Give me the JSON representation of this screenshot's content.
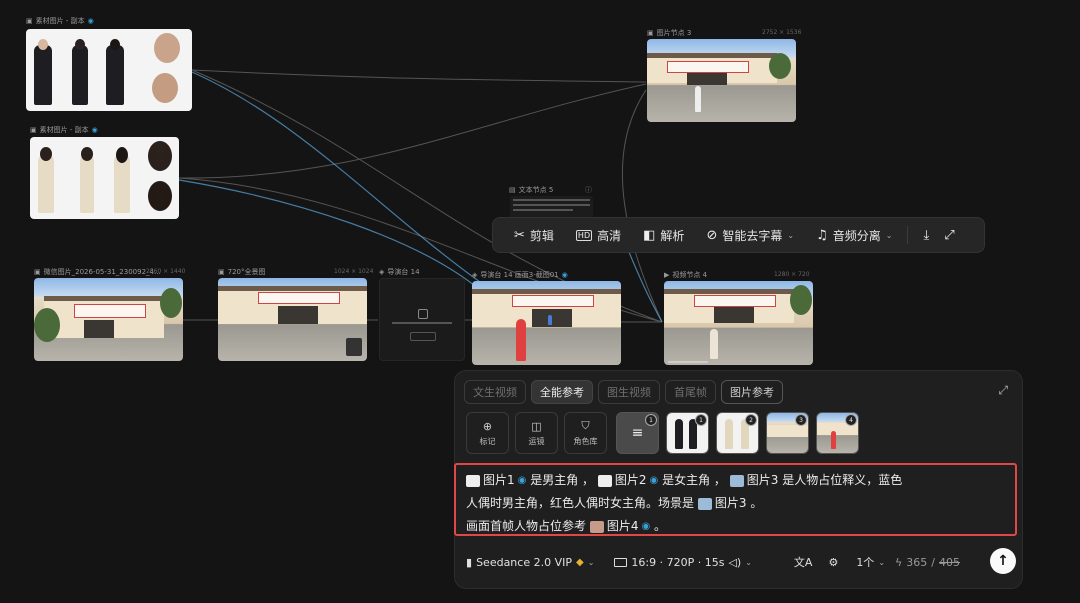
{
  "nodes": {
    "male_ref": {
      "label": "素材图片 - 副本"
    },
    "female_ref": {
      "label": "素材图片 - 副本"
    },
    "img_node3": {
      "label": "图片节点 3",
      "dim": "2752 × 1536"
    },
    "text_node5": {
      "label": "文本节点 5"
    },
    "wechat_img": {
      "label": "微信图片_2026-05-31_230092_4...",
      "dim": "2560 × 1440"
    },
    "panorama": {
      "label": "720°全景图",
      "dim": "1024 × 1024"
    },
    "director14": {
      "label": "导演台 14"
    },
    "director_shot": {
      "label": "导演台 14 画面3-截图01"
    },
    "video_node4": {
      "label": "视频节点 4",
      "dim": "1280 × 720"
    }
  },
  "toolbar": {
    "cut": "剪辑",
    "hd": "高清",
    "analyze": "解析",
    "remove_subs": "智能去字幕",
    "audio_split": "音频分离"
  },
  "panel": {
    "tabs": [
      "文生视频",
      "全能参考",
      "图生视频",
      "首尾帧",
      "图片参考"
    ],
    "tools": [
      "标记",
      "运镜",
      "角色库"
    ],
    "thumb_badges": [
      "1",
      "1",
      "2",
      "3",
      "4"
    ],
    "prompt": {
      "chip1": "图片1",
      "t1": "是男主角",
      "chip2": "图片2",
      "t2": "是女主角",
      "chip3": "图片3",
      "t3": "是人物占位释义，蓝色",
      "line2": "人偶时男主角，红色人偶时女主角。场景是",
      "chip4": "图片3",
      "t4": "。",
      "line3": "画面首帧人物占位参考",
      "chip5": "图片4",
      "t5": "。"
    },
    "bottom": {
      "model": "Seedance 2.0 VIP",
      "specs": "16:9 · 720P · 15s",
      "count": "1个",
      "credits": "365",
      "credits_strike": "405"
    }
  }
}
